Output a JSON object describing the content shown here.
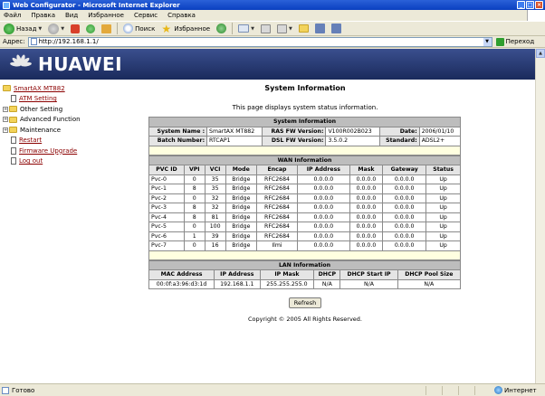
{
  "window": {
    "title": "Web Configurator - Microsoft Internet Explorer"
  },
  "menu": [
    "Файл",
    "Правка",
    "Вид",
    "Избранное",
    "Сервис",
    "Справка"
  ],
  "toolbar": {
    "back_label": "Назад",
    "search_label": "Поиск",
    "favorites_label": "Избранное"
  },
  "address": {
    "label": "Адрес:",
    "url": "http://192.168.1.1/",
    "go_label": "Переход"
  },
  "banner": {
    "brand": "HUAWEI"
  },
  "nav": {
    "root": "SmartAX MT882",
    "items": [
      {
        "label": "ATM Setting"
      },
      {
        "label": "Other Setting"
      },
      {
        "label": "Advanced Function"
      },
      {
        "label": "Maintenance"
      },
      {
        "label": "Restart"
      },
      {
        "label": "Firmware Upgrade"
      },
      {
        "label": "Log out"
      }
    ]
  },
  "main": {
    "title": "System Information",
    "description": "This page displays system status information.",
    "system": {
      "heading": "System Information",
      "system_name_label": "System Name :",
      "system_name": "SmartAX MT882",
      "ras_label": "RAS FW Version:",
      "ras": "V100R002B023",
      "date_label": "Date:",
      "date": "2006/01/10",
      "batch_label": "Batch Number:",
      "batch": "RTCAP1",
      "dsl_label": "DSL FW Version:",
      "dsl": "3.5.0.2",
      "standard_label": "Standard:",
      "standard": "ADSL2+"
    },
    "wan": {
      "heading": "WAN Information",
      "columns": [
        "PVC ID",
        "VPI",
        "VCI",
        "Mode",
        "Encap",
        "IP Address",
        "Mask",
        "Gateway",
        "Status"
      ],
      "rows": [
        [
          "Pvc-0",
          "0",
          "35",
          "Bridge",
          "RFC2684",
          "0.0.0.0",
          "0.0.0.0",
          "0.0.0.0",
          "Up"
        ],
        [
          "Pvc-1",
          "8",
          "35",
          "Bridge",
          "RFC2684",
          "0.0.0.0",
          "0.0.0.0",
          "0.0.0.0",
          "Up"
        ],
        [
          "Pvc-2",
          "0",
          "32",
          "Bridge",
          "RFC2684",
          "0.0.0.0",
          "0.0.0.0",
          "0.0.0.0",
          "Up"
        ],
        [
          "Pvc-3",
          "8",
          "32",
          "Bridge",
          "RFC2684",
          "0.0.0.0",
          "0.0.0.0",
          "0.0.0.0",
          "Up"
        ],
        [
          "Pvc-4",
          "8",
          "81",
          "Bridge",
          "RFC2684",
          "0.0.0.0",
          "0.0.0.0",
          "0.0.0.0",
          "Up"
        ],
        [
          "Pvc-5",
          "0",
          "100",
          "Bridge",
          "RFC2684",
          "0.0.0.0",
          "0.0.0.0",
          "0.0.0.0",
          "Up"
        ],
        [
          "Pvc-6",
          "1",
          "39",
          "Bridge",
          "RFC2684",
          "0.0.0.0",
          "0.0.0.0",
          "0.0.0.0",
          "Up"
        ],
        [
          "Pvc-7",
          "0",
          "16",
          "Bridge",
          "Ilmi",
          "0.0.0.0",
          "0.0.0.0",
          "0.0.0.0",
          "Up"
        ]
      ]
    },
    "lan": {
      "heading": "LAN Information",
      "columns": [
        "MAC Address",
        "IP Address",
        "IP Mask",
        "DHCP",
        "DHCP Start IP",
        "DHCP Pool Size"
      ],
      "row": [
        "00:0f:a3:96:d3:1d",
        "192.168.1.1",
        "255.255.255.0",
        "N/A",
        "N/A",
        "N/A"
      ]
    },
    "refresh_label": "Refresh",
    "copyright": "Copyright © 2005 All Rights Reserved."
  },
  "status": {
    "left": "Готово",
    "zone": "Интернет"
  }
}
